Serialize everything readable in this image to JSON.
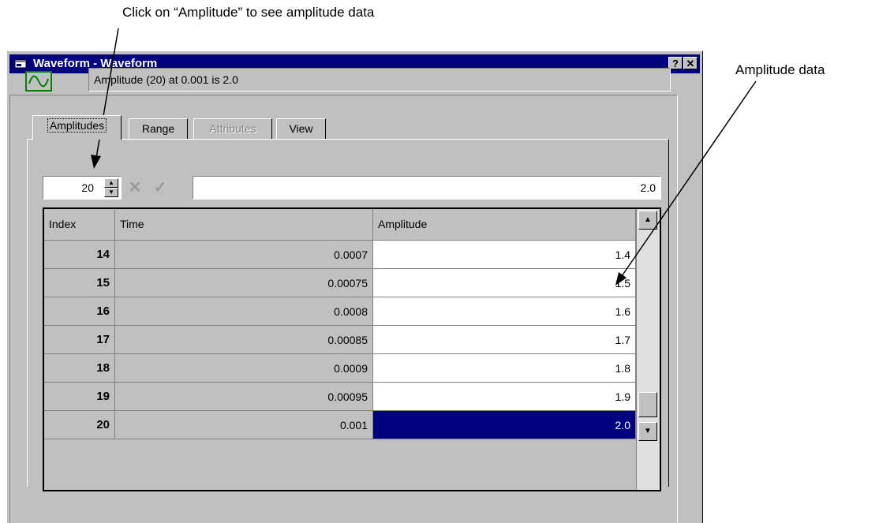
{
  "annotations": {
    "top_text": "Click on “Amplitude” to see amplitude data",
    "right_text": "Amplitude data"
  },
  "window": {
    "title": "Waveform - Waveform",
    "help_label": "?",
    "close_label": "✕",
    "title_bar_color": "#000080"
  },
  "status": {
    "icon": "waveform-icon",
    "text": "Amplitude (20) at 0.001 is 2.0"
  },
  "tabs": [
    {
      "label": "Amplitudes",
      "active": true,
      "enabled": true
    },
    {
      "label": "Range",
      "active": false,
      "enabled": true
    },
    {
      "label": "Attributes",
      "active": false,
      "enabled": false
    },
    {
      "label": "View",
      "active": false,
      "enabled": true
    }
  ],
  "editor": {
    "index_value": "20",
    "cancel_icon": "✕",
    "confirm_icon": "✓",
    "cell_value": "2.0"
  },
  "table": {
    "headers": [
      "Index",
      "Time",
      "Amplitude"
    ],
    "rows": [
      {
        "index": "14",
        "time": "0.0007",
        "amplitude": "1.4"
      },
      {
        "index": "15",
        "time": "0.00075",
        "amplitude": "1.5"
      },
      {
        "index": "16",
        "time": "0.0008",
        "amplitude": "1.6"
      },
      {
        "index": "17",
        "time": "0.00085",
        "amplitude": "1.7"
      },
      {
        "index": "18",
        "time": "0.0009",
        "amplitude": "1.8"
      },
      {
        "index": "19",
        "time": "0.00095",
        "amplitude": "1.9"
      },
      {
        "index": "20",
        "time": "0.001",
        "amplitude": "2.0",
        "selected": true
      }
    ]
  }
}
